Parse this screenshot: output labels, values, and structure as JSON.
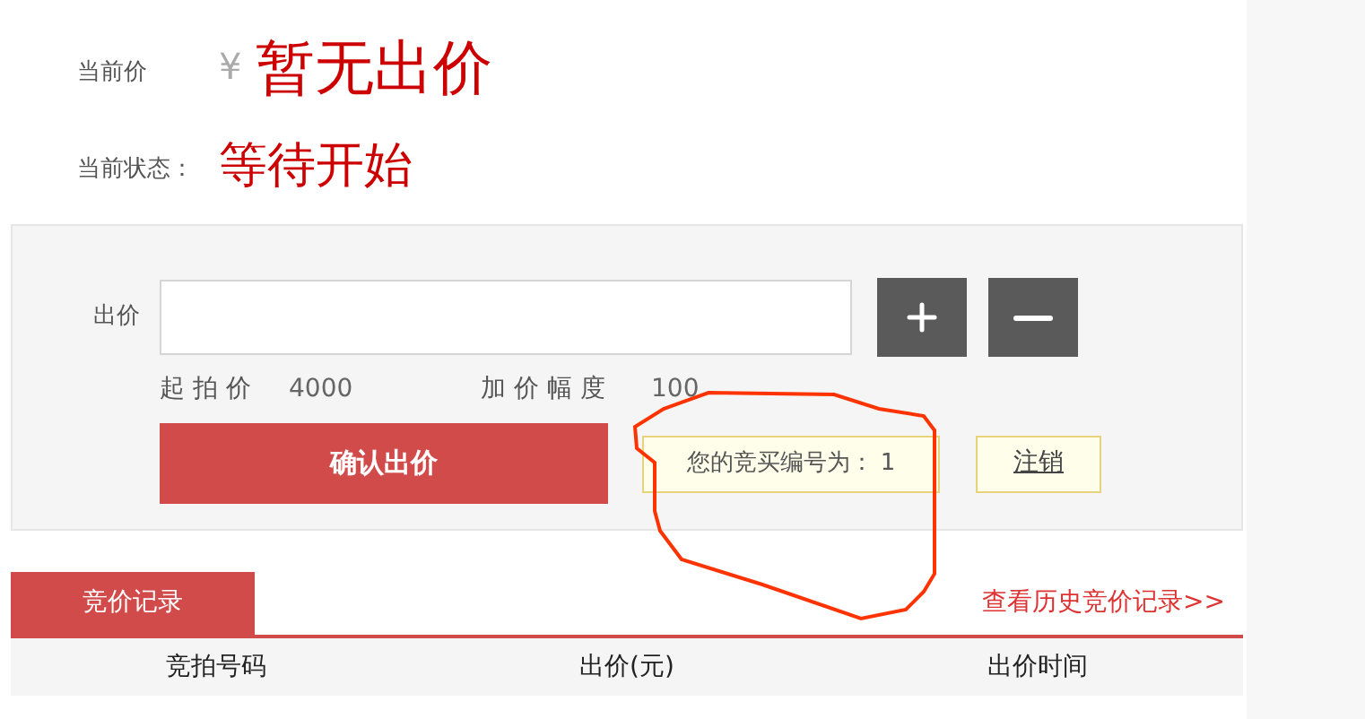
{
  "current_price": {
    "label": "当前价",
    "currency": "¥",
    "value": "暂无出价"
  },
  "status": {
    "label": "当前状态：",
    "value": "等待开始"
  },
  "bid_form": {
    "label": "出价",
    "start_price": {
      "label": "起 拍 价",
      "value": "4000"
    },
    "increment": {
      "label": "加 价 幅 度",
      "value": "100"
    },
    "confirm_button": "确认出价",
    "bidder_number": {
      "label": "您的竞买编号为：",
      "value": "1"
    },
    "logout_link": "注销"
  },
  "records": {
    "tabs": [
      {
        "label": "竞价记录",
        "selected": true
      }
    ],
    "history_link": "查看历史竞价记录>>",
    "columns": [
      "竞拍号码",
      "出价(元)",
      "出价时间"
    ]
  }
}
